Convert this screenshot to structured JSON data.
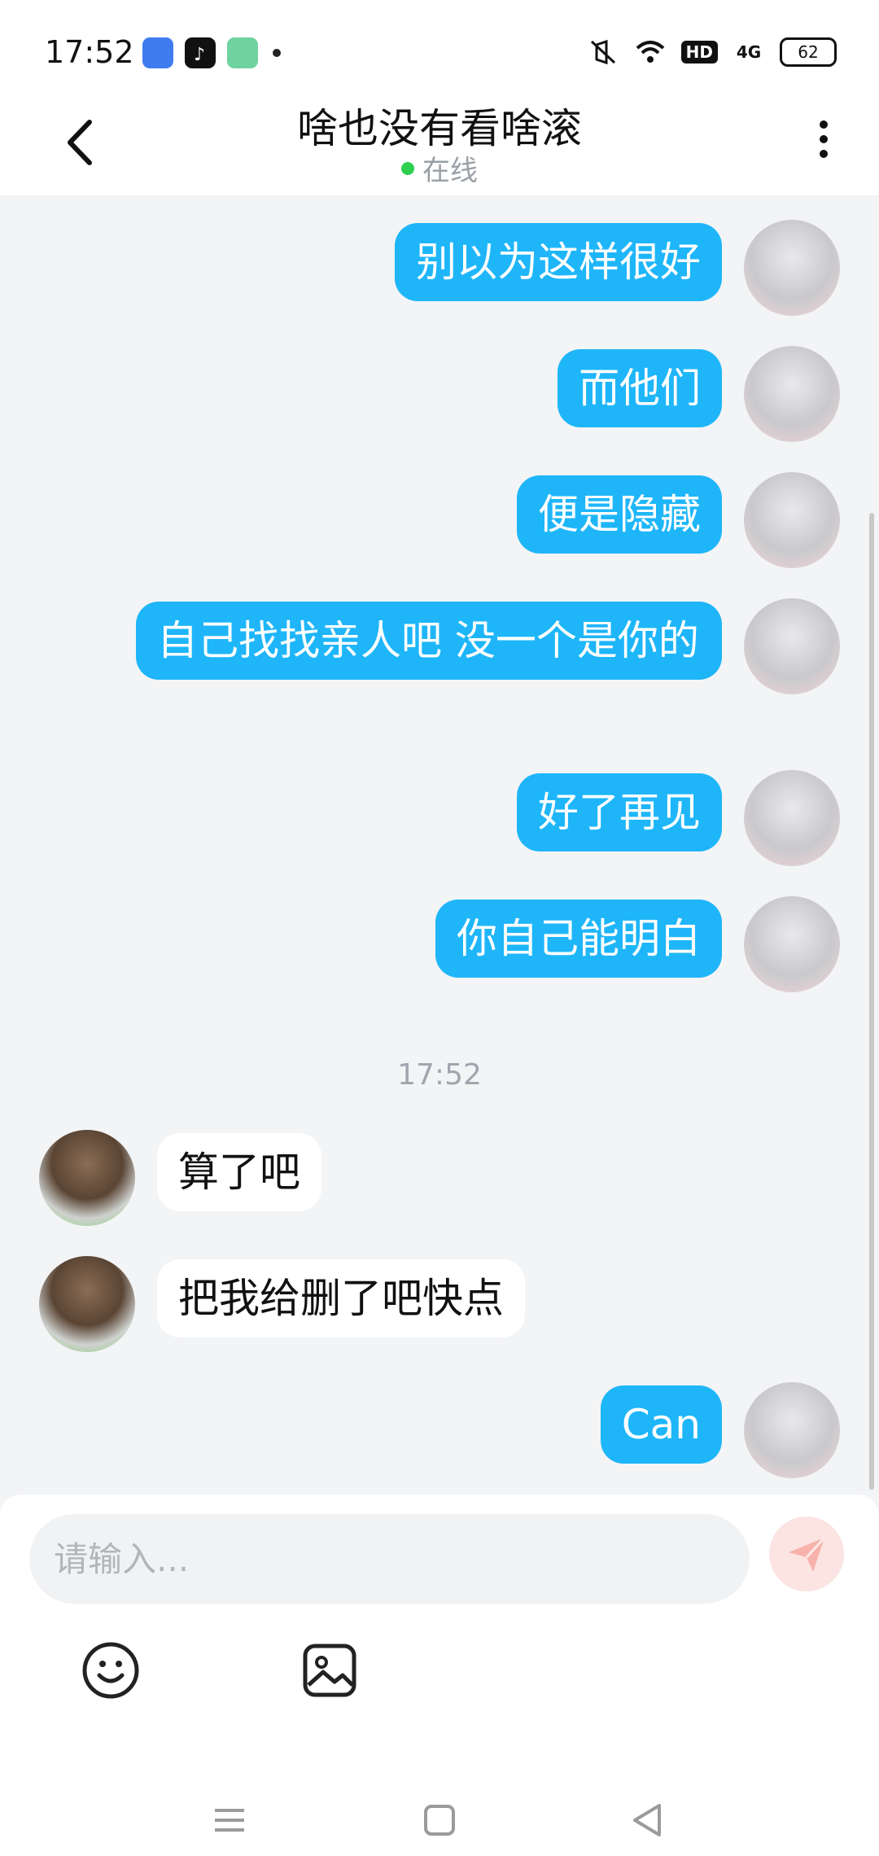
{
  "status_bar": {
    "time": "17:52",
    "network": "4G",
    "hd": "HD",
    "battery": "62",
    "icons": [
      "baidu-netdisk-icon",
      "tiktok-icon",
      "app-icon",
      "notification-dot",
      "mute-icon",
      "wifi-icon",
      "hd-icon",
      "signal-icon",
      "battery-icon"
    ]
  },
  "header": {
    "title": "啥也没有看啥滚",
    "presence": "在线",
    "presence_color": "#2fcf4f"
  },
  "messages": [
    {
      "dir": "out",
      "text": "别以为这样很好"
    },
    {
      "dir": "out",
      "text": "而他们"
    },
    {
      "dir": "out",
      "text": "便是隐藏"
    },
    {
      "dir": "out",
      "text": "自己找找亲人吧 没一个是你的"
    },
    {
      "dir": "out",
      "text": "好了再见"
    },
    {
      "dir": "out",
      "text": "你自己能明白"
    },
    {
      "dir": "time",
      "text": "17:52"
    },
    {
      "dir": "in",
      "text": "算了吧"
    },
    {
      "dir": "in",
      "text": "把我给删了吧快点"
    },
    {
      "dir": "out",
      "text": "Can"
    }
  ],
  "input": {
    "placeholder": "请输入..."
  },
  "colors": {
    "outgoing_bubble": "#1eb6f9",
    "incoming_bubble": "#ffffff",
    "background": "#f3f4f6",
    "send_button": "#fbe4e2"
  }
}
